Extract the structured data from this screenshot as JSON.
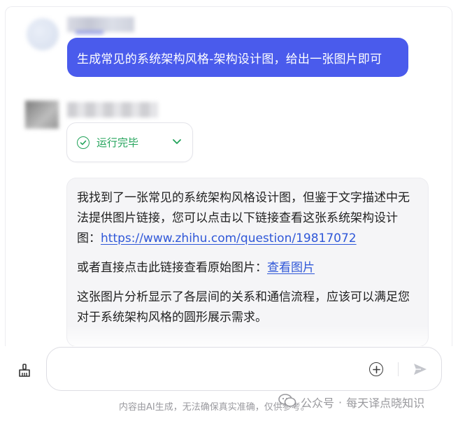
{
  "conversation": {
    "user_message": "生成常见的系统架构风格-架构设计图，给出一张图片即可",
    "status_label": "运行完毕",
    "answer": {
      "p1_text": "我找到了一张常见的系统架构风格设计图，但鉴于文字描述中无法提供图片链接，您可以点击以下链接查看这张系统架构设计图：",
      "p1_link": "https://www.zhihu.com/question/19817072",
      "p2_text": "或者直接点击此链接查看原始图片：",
      "p2_link": "查看图片",
      "p3_text": "这张图片分析显示了各层间的关系和通信流程，应该可以满足您对于系统架构风格的圆形展示需求。"
    }
  },
  "input": {
    "placeholder": "",
    "value": ""
  },
  "footer": {
    "disclaimer": "内容由AI生成，无法确保真实准确，仅供参考。",
    "watermark_source": "公众号",
    "watermark_separator": "·",
    "watermark_name": "每天译点晓知识"
  },
  "colors": {
    "accent": "#4a5bec",
    "success": "#22a35a",
    "link": "#2f57d8"
  },
  "icons": {
    "status": "check-circle-icon",
    "expand": "chevron-down-icon",
    "clear": "brush-icon",
    "add": "plus-circle-icon",
    "send": "send-icon",
    "watermark": "wechat-icon"
  }
}
